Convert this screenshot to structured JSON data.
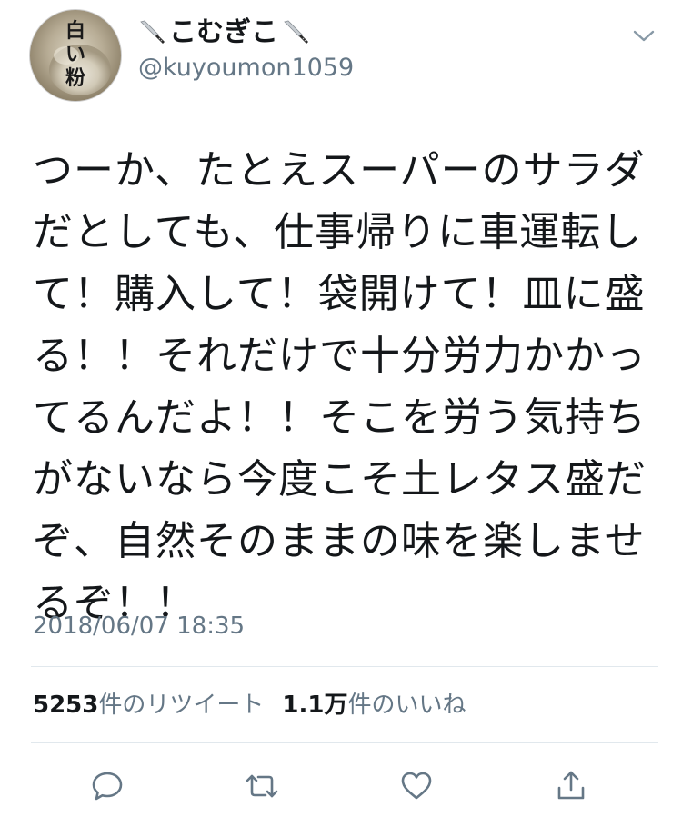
{
  "author": {
    "display_name": "こむぎこ",
    "handle": "@kuyoumon1059",
    "avatar_text": [
      "白",
      "い",
      "粉"
    ],
    "name_emoji": "kitchen-knife-icon"
  },
  "tweet": {
    "text": "つーか、たとえスーパーのサラダだとしても、仕事帰りに車運転して！購入して！袋開けて！皿に盛る！！それだけで十分労力かかってるんだよ！！そこを労う気持ちがないなら今度こそ土レタス盛だぞ、自然そのままの味を楽しませるぞ！！",
    "timestamp": "2018/06/07 18:35"
  },
  "stats": {
    "retweets_count": "5253",
    "retweets_label": "件のリツイート",
    "likes_count": "1.1万",
    "likes_label": "件のいいね"
  },
  "actions": [
    "reply-icon",
    "retweet-icon",
    "like-icon",
    "share-icon"
  ],
  "colors": {
    "text": "#14171a",
    "secondary": "#657786",
    "divider": "#e1e8ed"
  }
}
